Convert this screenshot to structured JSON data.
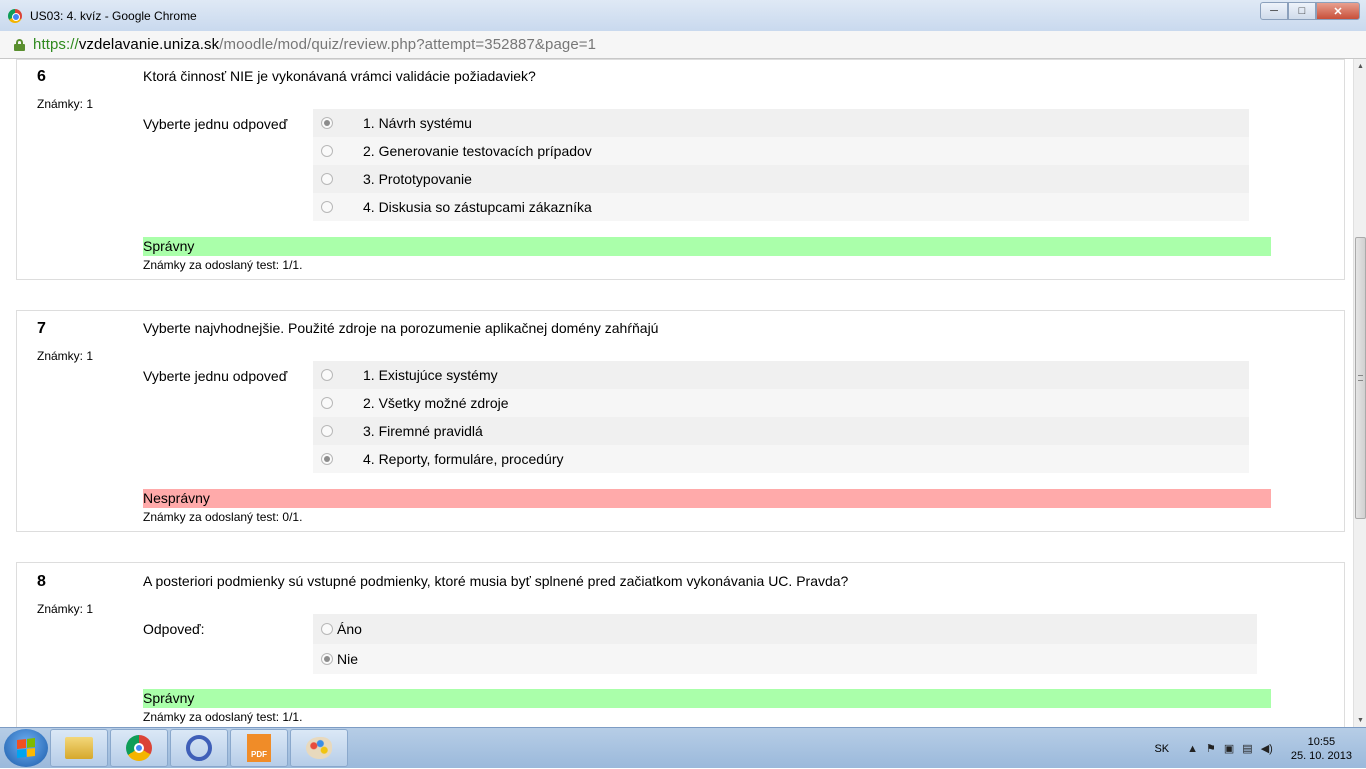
{
  "window": {
    "title": "US03: 4. kvíz - Google Chrome",
    "controls": {
      "minimize": "─",
      "maximize": "□",
      "close": "✕"
    }
  },
  "address": {
    "scheme": "https://",
    "host": "vzdelavanie.uniza.sk",
    "path": "/moodle/mod/quiz/review.php?attempt=352887&page=1"
  },
  "questions": [
    {
      "number": "6",
      "marks": "Známky: 1",
      "text": "Ktorá činnosť NIE je vykonávaná vrámci validácie požiadaviek?",
      "prompt": "Vyberte jednu odpoveď",
      "answers": [
        "1. Návrh systému",
        "2. Generovanie testovacích prípadov",
        "3. Prototypovanie",
        "4. Diskusia so zástupcami zákazníka"
      ],
      "selected": 0,
      "feedback": "Správny",
      "result": "Známky za odoslaný test: 1/1."
    },
    {
      "number": "7",
      "marks": "Známky: 1",
      "text": "Vyberte najvhodnejšie. Použité zdroje na porozumenie aplikačnej domény zahŕňajú",
      "prompt": "Vyberte jednu odpoveď",
      "answers": [
        "1. Existujúce systémy",
        "2. Všetky možné zdroje",
        "3. Firemné pravidlá",
        "4. Reporty, formuláre, procedúry"
      ],
      "selected": 3,
      "feedback": "Nesprávny",
      "result": "Známky za odoslaný test: 0/1."
    },
    {
      "number": "8",
      "marks": "Známky: 1",
      "text": "A posteriori podmienky sú vstupné podmienky, ktoré musia byť splnené pred začiatkom vykonávania UC. Pravda?",
      "prompt": "Odpoveď:",
      "answers": [
        "Áno",
        "Nie"
      ],
      "selected": 1,
      "feedback": "Správny",
      "result": "Známky za odoslaný test: 1/1."
    }
  ],
  "taskbar": {
    "pdf_label": "PDF",
    "language": "SK",
    "time": "10:55",
    "date": "25. 10. 2013",
    "tray_icons": [
      "▲",
      "⚑",
      "▣",
      "▤",
      "◀)"
    ]
  },
  "colors": {
    "correct": "#aaffaa",
    "incorrect": "#ffaaaa"
  }
}
